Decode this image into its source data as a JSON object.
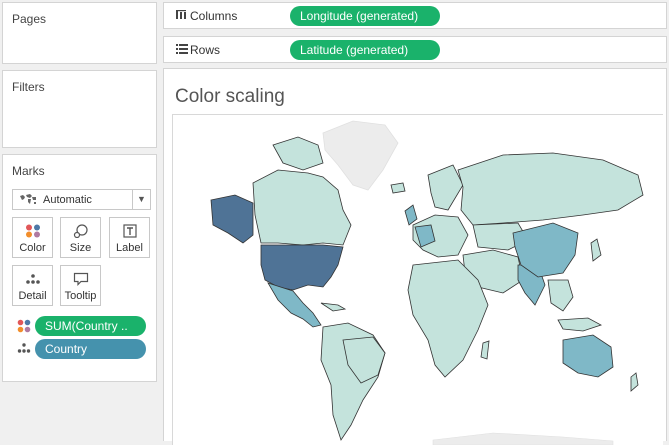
{
  "panels": {
    "pages": "Pages",
    "filters": "Filters",
    "marks": "Marks"
  },
  "marks": {
    "type_value": "Automatic",
    "buttons": {
      "color": "Color",
      "size": "Size",
      "label": "Label",
      "detail": "Detail",
      "tooltip": "Tooltip"
    },
    "fields": [
      {
        "label": "SUM(Country ..",
        "encoding": "color",
        "color": "#1ab26b"
      },
      {
        "label": "Country",
        "encoding": "detail",
        "color": "#4592ad"
      }
    ]
  },
  "shelves": {
    "columns": {
      "label": "Columns",
      "pill": "Longitude (generated)"
    },
    "rows": {
      "label": "Rows",
      "pill": "Latitude (generated)"
    }
  },
  "view": {
    "title": "Color scaling"
  },
  "colors": {
    "pill_green": "#1ab26b",
    "pill_blue": "#4592ad",
    "map_low": "#c4e3dc",
    "map_mid": "#7fb8c7",
    "map_high": "#4f7396",
    "map_border": "#333333"
  }
}
